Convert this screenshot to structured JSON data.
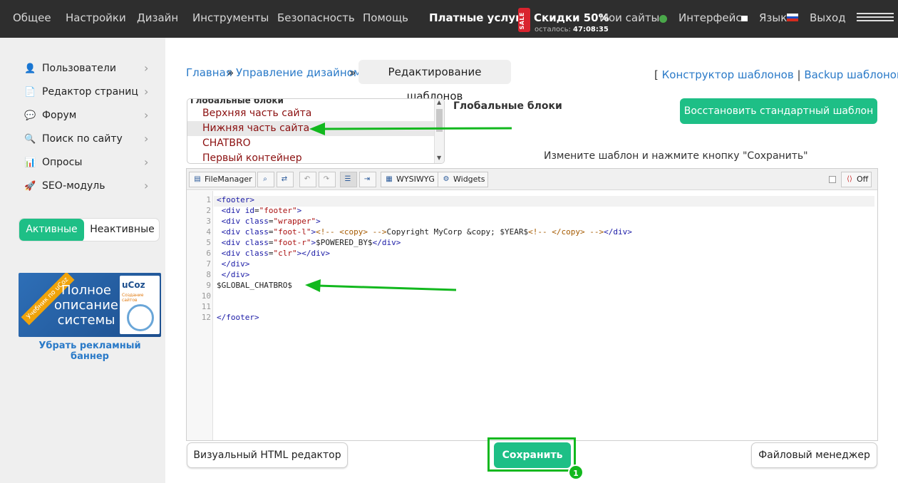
{
  "topnav": {
    "items": [
      "Общее",
      "Настройки",
      "Дизайн",
      "Инструменты",
      "Безопасность",
      "Помощь"
    ],
    "paid": "Платные услуги",
    "sale_tag": "SALE",
    "discount": "Скидки 50%",
    "timer_label": "осталось:",
    "timer_value": "47:08:35",
    "my_sites": "Мои сайты",
    "interface": "Интерфейс",
    "language": "Язык",
    "logout": "Выход"
  },
  "sidebar": {
    "items": [
      {
        "label": "Пользователи",
        "icon": "user-icon"
      },
      {
        "label": "Редактор страниц",
        "icon": "page-icon"
      },
      {
        "label": "Форум",
        "icon": "chat-icon"
      },
      {
        "label": "Поиск по сайту",
        "icon": "search-icon"
      },
      {
        "label": "Опросы",
        "icon": "chart-icon"
      },
      {
        "label": "SEO-модуль",
        "icon": "rocket-icon"
      }
    ],
    "toggle_active": "Активные",
    "toggle_inactive": "Неактивные",
    "banner": {
      "ribbon": "Учебник по uCoz",
      "text": "Полное описание системы",
      "book_title": "uCoz",
      "book_subtitle": "Создание сайтов"
    },
    "remove_banner": "Убрать рекламный баннер"
  },
  "breadcrumb": {
    "home": "Главная",
    "sep": "»",
    "design": "Управление дизайном",
    "current": "Редактирование шаблонов"
  },
  "toplinks": {
    "open": "[",
    "constructor": "Конструктор шаблонов",
    "divider": "|",
    "backup": "Backup шаблонов",
    "close": "]"
  },
  "blocks": {
    "list_header": "Глобальные блоки",
    "options": [
      "Верхняя часть сайта",
      "Нижняя часть сайта",
      "CHATBRO",
      "Первый контейнер"
    ],
    "selected_index": 1,
    "title": "Глобальные блоки",
    "restore_button": "Восстановить стандартный шаблон",
    "hint": "Измените шаблон и нажмите кнопку \"Сохранить\""
  },
  "toolbar": {
    "filemanager": "FileManager",
    "wysiwyg": "WYSIWYG",
    "widgets": "Widgets",
    "off": "Off"
  },
  "code": {
    "line_numbers": [
      "1",
      "2",
      "3",
      "4",
      "5",
      "6",
      "7",
      "8",
      "9",
      "10",
      "11",
      "12"
    ],
    "line1_tag": "<footer>",
    "line2_a": " <div ",
    "line2_b": "id",
    "line2_c": "=",
    "line2_d": "\"footer\"",
    "line2_e": ">",
    "line3_a": " <div ",
    "line3_b": "class",
    "line3_c": "=",
    "line3_d": "\"wrapper\"",
    "line3_e": ">",
    "line4_a": " <div ",
    "line4_b": "class",
    "line4_c": "=",
    "line4_d": "\"foot-l\"",
    "line4_e": ">",
    "line4_f": "<!-- <copy> -->",
    "line4_g": "Copyright MyCorp &copy; $YEAR$",
    "line4_h": "<!-- </copy> -->",
    "line4_i": "</div>",
    "line5_a": " <div ",
    "line5_b": "class",
    "line5_c": "=",
    "line5_d": "\"foot-r\"",
    "line5_e": ">",
    "line5_f": "$POWERED_BY$",
    "line5_g": "</div>",
    "line6_a": " <div ",
    "line6_b": "class",
    "line6_c": "=",
    "line6_d": "\"clr\"",
    "line6_e": "></div>",
    "line7": " </div>",
    "line8": " </div>",
    "line9": "$GLOBAL_CHATBRO$",
    "line12": "</footer>"
  },
  "bottom": {
    "visual_editor": "Визуальный HTML редактор",
    "save": "Сохранить",
    "badge": "1",
    "file_manager": "Файловый менеджер"
  },
  "colors": {
    "accent_green": "#1ebf86",
    "annotation_green": "#12b81e",
    "link_blue": "#2a7ac8",
    "topbar": "#2e2e2e"
  }
}
